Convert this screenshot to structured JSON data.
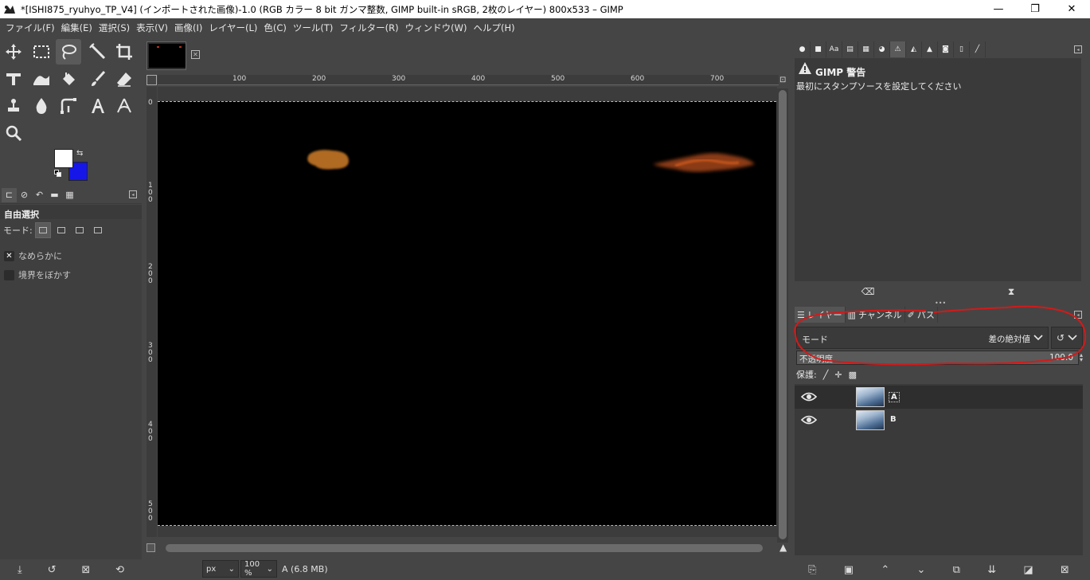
{
  "window": {
    "title": "*[ISHI875_ryuhyo_TP_V4] (インポートされた画像)-1.0 (RGB カラー 8 bit ガンマ整数, GIMP built-in sRGB, 2枚のレイヤー) 800x533 – GIMP",
    "min": "—",
    "max": "❐",
    "close": "✕"
  },
  "menu": [
    "ファイル(F)",
    "編集(E)",
    "選択(S)",
    "表示(V)",
    "画像(I)",
    "レイヤー(L)",
    "色(C)",
    "ツール(T)",
    "フィルター(R)",
    "ウィンドウ(W)",
    "ヘルプ(H)"
  ],
  "colors": {
    "foreground": "#ffffff",
    "background": "#1616e8",
    "annotation": "#d21a1a"
  },
  "tool_options": {
    "title": "自由選択",
    "mode_label": "モード:",
    "antialias_label": "なめらかに",
    "antialias_checked": true,
    "feather_label": "境界をぼかす",
    "feather_checked": false
  },
  "canvas": {
    "ruler_h": [
      "100",
      "200",
      "300",
      "400",
      "500",
      "600",
      "700"
    ],
    "ruler_v": [
      "0",
      "1\n0\n0",
      "2\n0\n0",
      "3\n0\n0",
      "4\n0\n0",
      "5\n0\n0"
    ],
    "unit": "px",
    "zoom": "100 %",
    "status": "A (6.8 MB)"
  },
  "warning": {
    "title": "GIMP 警告",
    "message": "最初にスタンプソースを設定してください"
  },
  "layers_panel": {
    "tabs": [
      "レイヤー",
      "チャンネル",
      "パス"
    ],
    "mode_label": "モード",
    "mode_value": "差の絶対値",
    "opacity_label": "不透明度",
    "opacity_value": "100.0",
    "lock_label": "保護:",
    "layers": [
      {
        "name": "A",
        "visible": true,
        "selected": true
      },
      {
        "name": "B",
        "visible": true,
        "selected": false
      }
    ]
  }
}
